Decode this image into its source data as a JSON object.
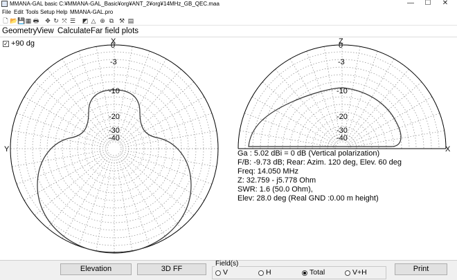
{
  "window": {
    "title": "MMANA-GAL basic C:¥MMANA-GAL_Basic¥org¥ANT_2¥org¥14MHz_GB_QEC.maa",
    "minimize": "—",
    "maximize": "☐",
    "close": "✕"
  },
  "menu": [
    "File",
    "Edit",
    "Tools",
    "Setup",
    "Help",
    "MMANA-GAL.pro"
  ],
  "toolbar_icons": [
    {
      "name": "new-file-icon",
      "glyph": "🗋"
    },
    {
      "name": "open-folder-icon",
      "glyph": "📂"
    },
    {
      "name": "save-icon",
      "glyph": "💾"
    },
    {
      "name": "table-icon",
      "glyph": "▦"
    },
    {
      "name": "print-icon",
      "glyph": "🖶"
    },
    {
      "name": "move-icon",
      "glyph": "✥"
    },
    {
      "name": "rotate-icon",
      "glyph": "↻"
    },
    {
      "name": "scale-icon",
      "glyph": "⤧"
    },
    {
      "name": "wire-edit-icon",
      "glyph": "☰"
    },
    {
      "name": "chart-icon",
      "glyph": "◩"
    },
    {
      "name": "triangle-icon",
      "glyph": "△"
    },
    {
      "name": "target-icon",
      "glyph": "⊕"
    },
    {
      "name": "copy-icon",
      "glyph": "⧉"
    },
    {
      "name": "tools-icon",
      "glyph": "⚒"
    },
    {
      "name": "calculator-icon",
      "glyph": "▤"
    }
  ],
  "tabs": [
    "Geometry",
    "View",
    "Calculate",
    "Far field plots"
  ],
  "checkbox": {
    "label": "+90 dg",
    "checked": true
  },
  "horizontal_plot": {
    "label_top": "X",
    "label_left": "Y",
    "rings": [
      "0",
      "-3",
      "-10",
      "-20",
      "-30",
      "-40"
    ]
  },
  "vertical_plot": {
    "label_top": "Z",
    "label_right": "X",
    "rings": [
      "0",
      "-3",
      "-10",
      "-20",
      "-30",
      "-40"
    ]
  },
  "info": {
    "ga": "Ga : 5.02 dBi = 0 dB  (Vertical polarization)",
    "fb": "F/B: -9.73 dB; Rear: Azim. 120 deg,  Elev. 60 deg",
    "freq": "Freq: 14.050 MHz",
    "z": "Z: 32.759 - j5.778 Ohm",
    "swr": "SWR: 1.6 (50.0 Ohm),",
    "elev": "Elev: 28.0 deg (Real GND  :0.00 m height)"
  },
  "buttons": {
    "elevation": "Elevation",
    "view3d": "3D FF",
    "print": "Print"
  },
  "fields": {
    "title": "Field(s)",
    "options": [
      {
        "label": "V",
        "selected": false
      },
      {
        "label": "H",
        "selected": false
      },
      {
        "label": "Total",
        "selected": true
      },
      {
        "label": "V+H",
        "selected": false
      }
    ]
  }
}
